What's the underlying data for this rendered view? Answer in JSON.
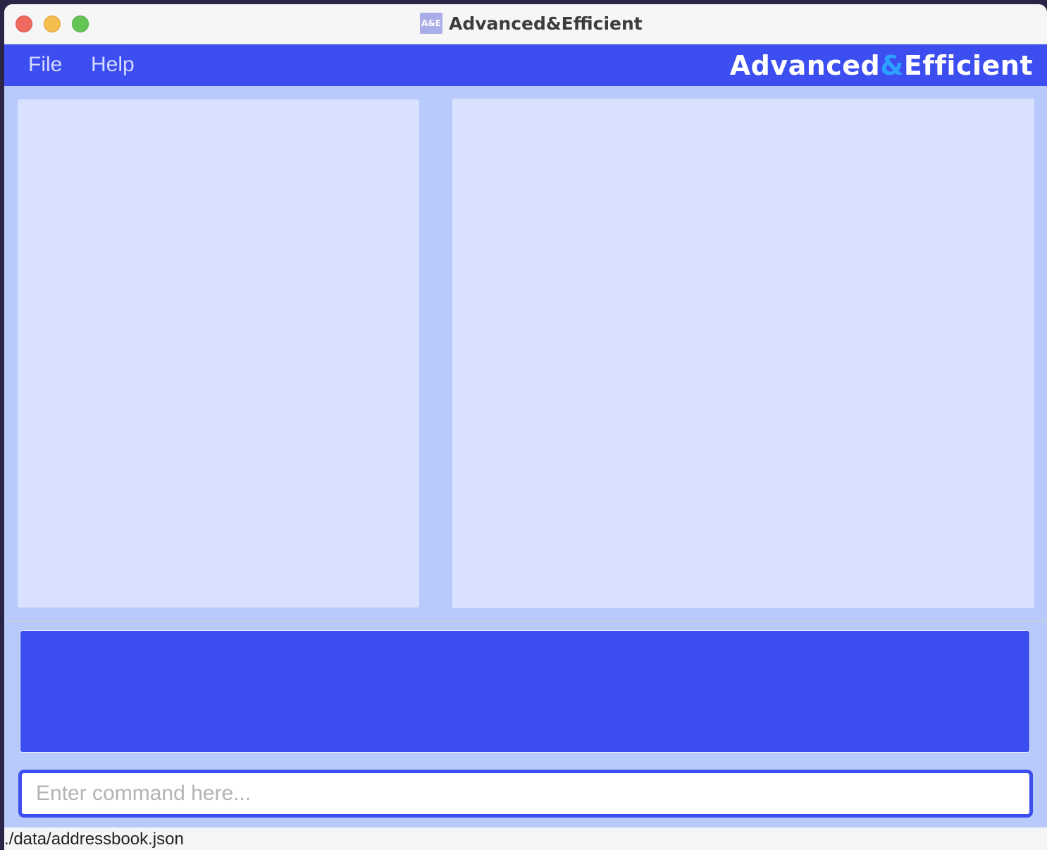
{
  "window": {
    "title": "Advanced&Efficient",
    "icon_text": "A&E",
    "icon_name": "app-logo-icon"
  },
  "menu": {
    "items": [
      {
        "label": "File"
      },
      {
        "label": "Help"
      }
    ]
  },
  "brand": {
    "part1": "Advanced",
    "amp": "&",
    "part2": "Efficient"
  },
  "command": {
    "placeholder": "Enter command here...",
    "value": ""
  },
  "status": {
    "save_location": "./data/addressbook.json"
  },
  "colors": {
    "accent": "#3d4ef0",
    "background": "#b8c9fb",
    "panel": "#d8e2fe",
    "brand_amp": "#2ea0ff"
  }
}
